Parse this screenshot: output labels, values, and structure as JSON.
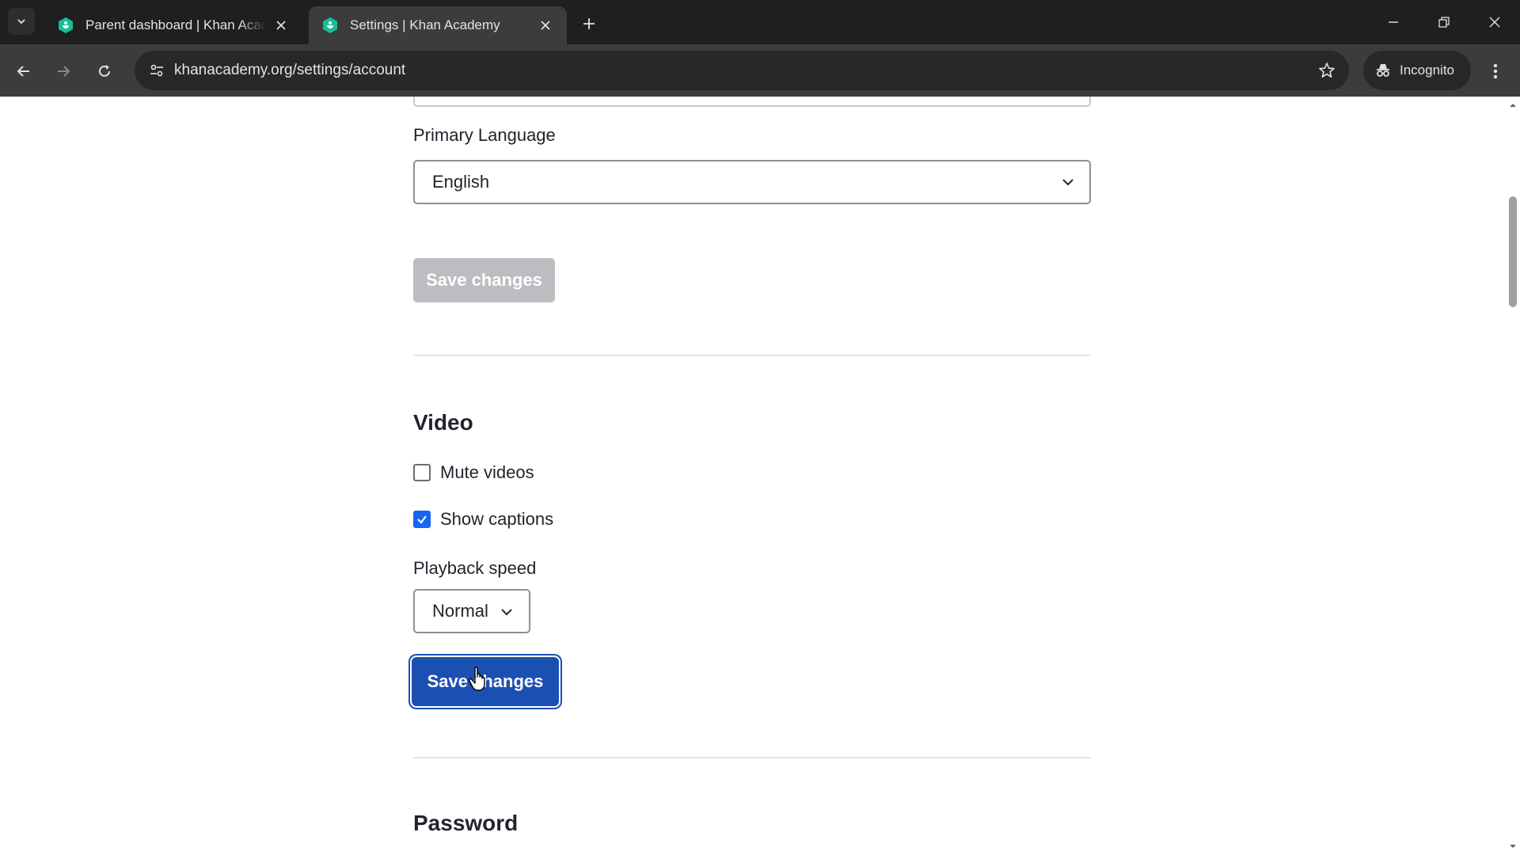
{
  "browser": {
    "tabs": [
      {
        "title": "Parent dashboard | Khan Academy",
        "active": false
      },
      {
        "title": "Settings | Khan Academy",
        "active": true
      }
    ],
    "url": "khanacademy.org/settings/account",
    "incognito_label": "Incognito"
  },
  "colors": {
    "primary_button": "#1b50b3",
    "checkbox_checked": "#1865f2",
    "favicon": "#14bf96"
  },
  "settings": {
    "language": {
      "label": "Primary Language",
      "value": "English",
      "save_label": "Save changes",
      "save_enabled": false
    },
    "video": {
      "heading": "Video",
      "mute_label": "Mute videos",
      "mute_checked": false,
      "captions_label": "Show captions",
      "captions_checked": true,
      "speed_label": "Playback speed",
      "speed_value": "Normal",
      "save_label": "Save changes",
      "save_enabled": true
    },
    "password": {
      "heading": "Password"
    }
  }
}
